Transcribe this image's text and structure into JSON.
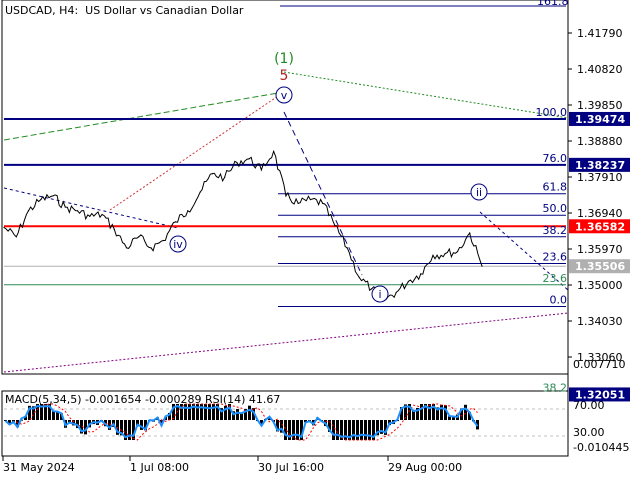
{
  "header": {
    "symbol": "USDCAD, H4:",
    "description": "US Dollar vs Canadian Dollar"
  },
  "colors": {
    "price_line": "#000000",
    "red_level": "#ff0000",
    "blue_level": "#000080",
    "fib_line": "#000080",
    "fib_text": "#000080",
    "green_fib_line": "#2e8b57",
    "green_fib_text": "#2e8b57",
    "wave_label": "#000080",
    "wave_green": "#228b22",
    "wave_red": "#b22222",
    "macd_hist": "#000000",
    "macd_signal": "#ff0000",
    "rsi_line": "#1e90ff",
    "grid": "#c0c0c0"
  },
  "chart_data": {
    "type": "line",
    "title": "USDCAD, H4:  US Dollar vs Canadian Dollar",
    "xlabel": "",
    "ylabel": "",
    "ylim": [
      1.3116,
      1.42474
    ],
    "grid": false,
    "price_axis_labels": [
      "1.41790",
      "1.40820",
      "1.39850",
      "1.38880",
      "1.37910",
      "1.36940",
      "1.35970",
      "1.35000",
      "1.34030",
      "1.33060"
    ],
    "time_axis_labels": [
      "31 May 2024",
      "1 Jul 08:00",
      "30 Jul 16:00",
      "29 Aug 00:00"
    ],
    "price_series": {
      "x": [
        "31 May 2024",
        "3 Jun",
        "5 Jun",
        "7 Jun",
        "11 Jun",
        "13 Jun",
        "17 Jun",
        "19 Jun",
        "21 Jun",
        "25 Jun",
        "27 Jun",
        "1 Jul 08:00",
        "3 Jul",
        "5 Jul",
        "9 Jul",
        "11 Jul",
        "15 Jul",
        "17 Jul",
        "19 Jul",
        "23 Jul",
        "25 Jul",
        "29 Jul",
        "30 Jul 16:00",
        "1 Aug",
        "5 Aug",
        "7 Aug",
        "9 Aug",
        "13 Aug",
        "15 Aug",
        "19 Aug",
        "21 Aug",
        "23 Aug",
        "27 Aug",
        "29 Aug 00:00",
        "2 Sep",
        "4 Sep",
        "6 Sep",
        "9 Sep",
        "11 Sep",
        "12 Sep"
      ],
      "y": [
        1.3655,
        1.363,
        1.37,
        1.373,
        1.374,
        1.371,
        1.37,
        1.3685,
        1.369,
        1.365,
        1.36,
        1.363,
        1.36,
        1.362,
        1.367,
        1.37,
        1.375,
        1.38,
        1.379,
        1.383,
        1.384,
        1.381,
        1.386,
        1.374,
        1.372,
        1.373,
        1.372,
        1.366,
        1.36,
        1.352,
        1.349,
        1.346,
        1.348,
        1.351,
        1.353,
        1.358,
        1.3585,
        1.359,
        1.364,
        1.3551
      ]
    },
    "horizontal_levels": [
      {
        "label": "1.39474",
        "color": "blue"
      },
      {
        "label": "1.38237",
        "color": "blue"
      },
      {
        "label": "1.36582",
        "color": "red"
      },
      {
        "label": "1.35506",
        "color": "gray"
      },
      {
        "label": "1.32051",
        "color": "blue"
      }
    ],
    "fib_top_label": "161.8",
    "fib_retracement_labels": [
      "100.0",
      "76.0",
      "61.8",
      "50.0",
      "38.2",
      "23.6",
      "0.0"
    ],
    "fib_green_labels": [
      "23.6",
      "38.2"
    ],
    "wave_labels": [
      "(1)",
      "5",
      "v",
      "iv",
      "i",
      "ii"
    ],
    "indicator": {
      "label": "MACD(5,34,5) -0.001654 -0.000289 RSI(14) 41.67",
      "macd": -0.001654,
      "signal": -0.000289,
      "rsi": 41.67,
      "axis_labels": [
        "0.007710",
        "70.00",
        "30.00",
        "-0.010445"
      ]
    }
  }
}
